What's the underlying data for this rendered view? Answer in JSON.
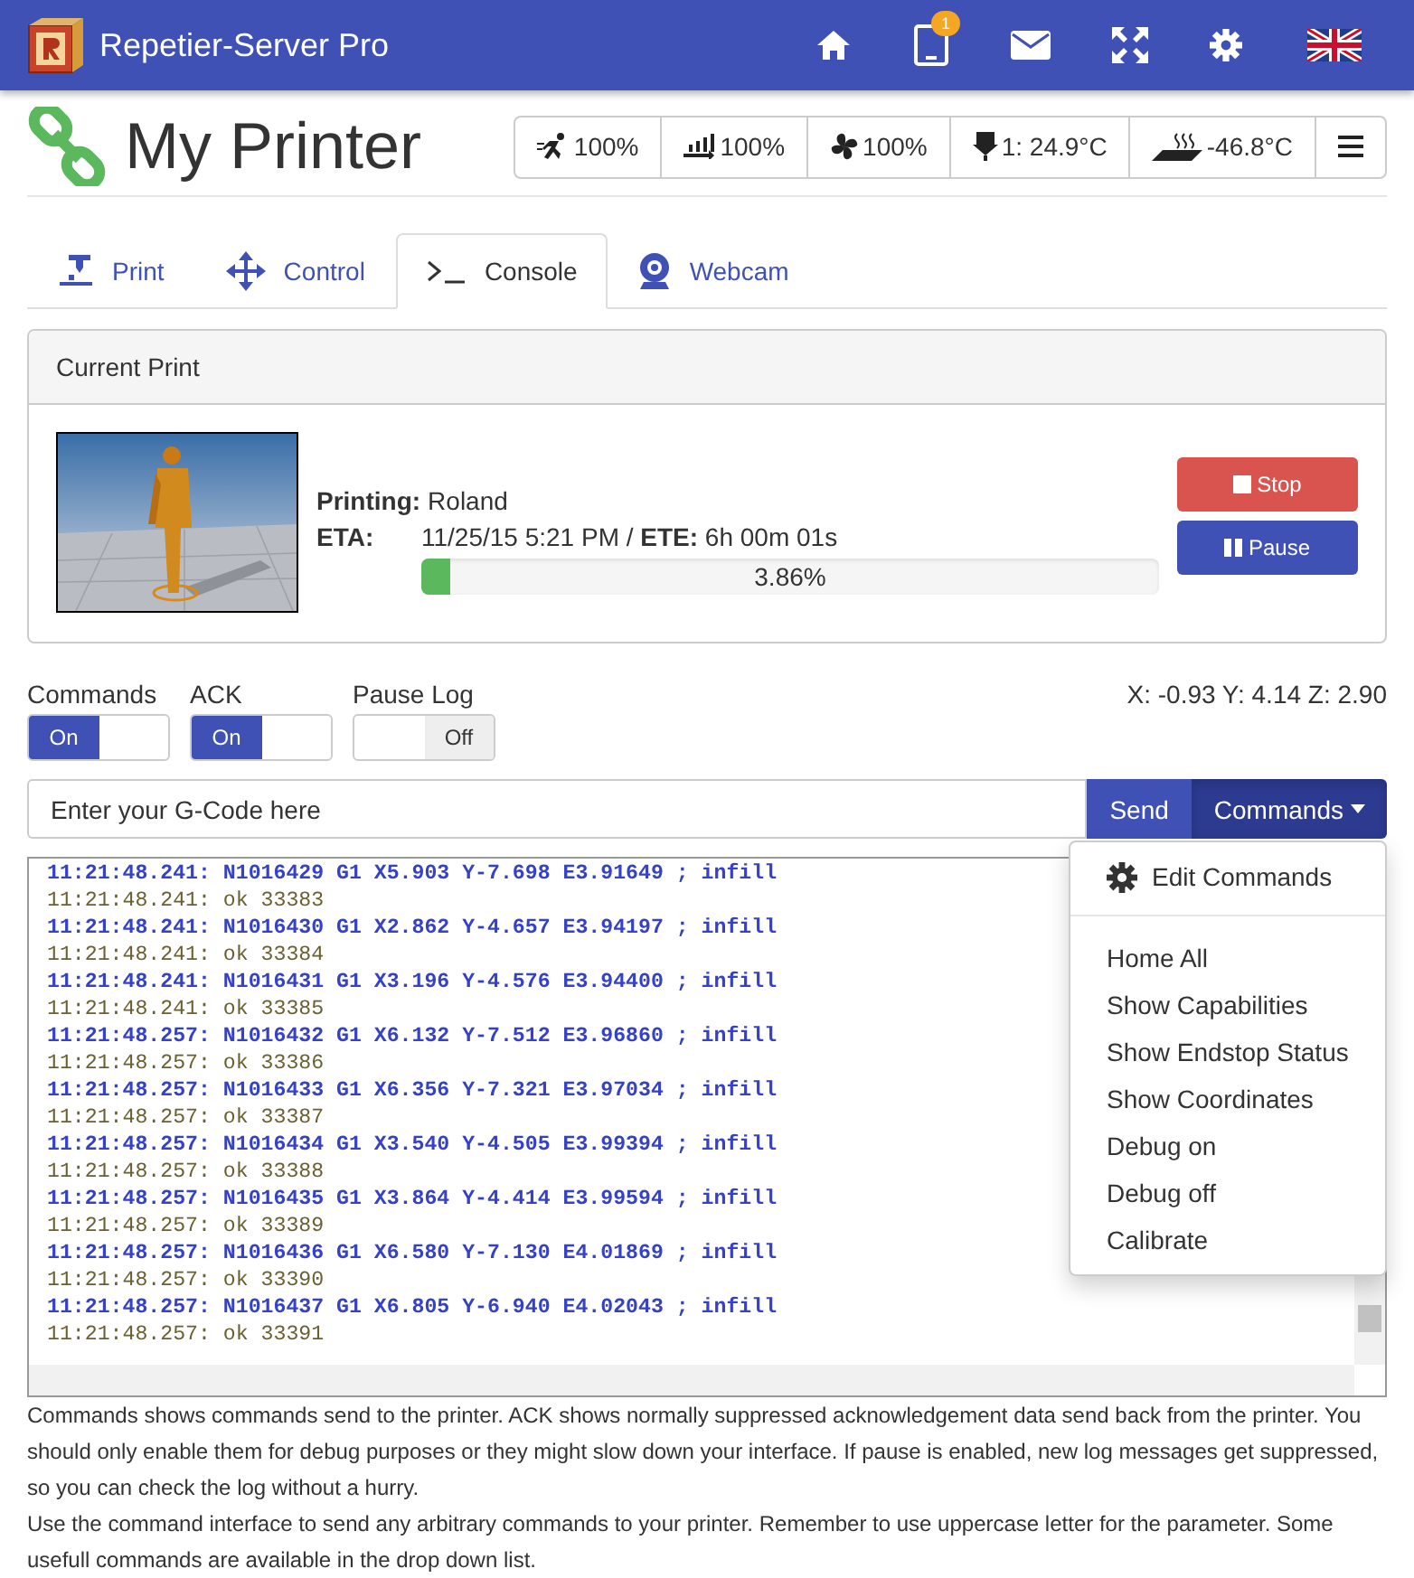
{
  "header": {
    "app_title": "Repetier-Server Pro",
    "notification_count": "1"
  },
  "printer": {
    "name": "My Printer"
  },
  "status": [
    {
      "kind": "speed",
      "text": "100%"
    },
    {
      "kind": "flow",
      "text": "100%"
    },
    {
      "kind": "fan",
      "text": "100%"
    },
    {
      "kind": "extruder",
      "text": "1: 24.9°C"
    },
    {
      "kind": "bed",
      "text": "-46.8°C"
    },
    {
      "kind": "menu"
    }
  ],
  "tabs": [
    {
      "kind": "print",
      "label": "Print",
      "selected": false
    },
    {
      "kind": "control",
      "label": "Control",
      "selected": false
    },
    {
      "kind": "console",
      "label": "Console",
      "selected": true
    },
    {
      "kind": "webcam",
      "label": "Webcam",
      "selected": false
    }
  ],
  "current_print": {
    "title": "Current Print",
    "printing_label": "Printing:",
    "printing": "Roland",
    "eta_label": "ETA:",
    "eta": "11/25/15 5:21 PM / **ETE:** 6h 00m 01s",
    "progress_text": "3.86%",
    "level": 0.0386,
    "stop": "Stop",
    "pause": "Pause"
  },
  "toggles": [
    {
      "label": "Commands",
      "on": true,
      "state_text": "On"
    },
    {
      "label": "ACK",
      "on": true,
      "state_text": "On"
    },
    {
      "label": "Pause Log",
      "on": false,
      "state_text": "Off"
    }
  ],
  "coordinates": "X: -0.93 Y: 4.14 Z: 2.90",
  "gcode": {
    "placeholder": "Enter your G-Code here",
    "send": "Send",
    "commands": "Commands"
  },
  "console": [
    {
      "kind": "command",
      "text": "11:21:48.241: N1016429 G1 X5.903 Y-7.698 E3.91649 ; infill"
    },
    {
      "kind": "response",
      "text": "11:21:48.241: ok 33383"
    },
    {
      "kind": "command",
      "text": "11:21:48.241: N1016430 G1 X2.862 Y-4.657 E3.94197 ; infill"
    },
    {
      "kind": "response",
      "text": "11:21:48.241: ok 33384"
    },
    {
      "kind": "command",
      "text": "11:21:48.241: N1016431 G1 X3.196 Y-4.576 E3.94400 ; infill"
    },
    {
      "kind": "response",
      "text": "11:21:48.241: ok 33385"
    },
    {
      "kind": "command",
      "text": "11:21:48.257: N1016432 G1 X6.132 Y-7.512 E3.96860 ; infill"
    },
    {
      "kind": "response",
      "text": "11:21:48.257: ok 33386"
    },
    {
      "kind": "command",
      "text": "11:21:48.257: N1016433 G1 X6.356 Y-7.321 E3.97034 ; infill"
    },
    {
      "kind": "response",
      "text": "11:21:48.257: ok 33387"
    },
    {
      "kind": "command",
      "text": "11:21:48.257: N1016434 G1 X3.540 Y-4.505 E3.99394 ; infill"
    },
    {
      "kind": "response",
      "text": "11:21:48.257: ok 33388"
    },
    {
      "kind": "command",
      "text": "11:21:48.257: N1016435 G1 X3.864 Y-4.414 E3.99594 ; infill"
    },
    {
      "kind": "response",
      "text": "11:21:48.257: ok 33389"
    },
    {
      "kind": "command",
      "text": "11:21:48.257: N1016436 G1 X6.580 Y-7.130 E4.01869 ; infill"
    },
    {
      "kind": "response",
      "text": "11:21:48.257: ok 33390"
    },
    {
      "kind": "command",
      "text": "11:21:48.257: N1016437 G1 X6.805 Y-6.940 E4.02043 ; infill"
    },
    {
      "kind": "response",
      "text": "11:21:48.257: ok 33391"
    }
  ],
  "commands_menu": {
    "expanded": true,
    "items": [
      {
        "kind": "edit",
        "label": "Edit Commands"
      },
      {
        "kind": "command",
        "label": "Home All"
      },
      {
        "kind": "command",
        "label": "Show Capabilities"
      },
      {
        "kind": "command",
        "label": "Show Endstop Status"
      },
      {
        "kind": "command",
        "label": "Show Coordinates"
      },
      {
        "kind": "command",
        "label": "Debug on"
      },
      {
        "kind": "command",
        "label": "Debug off"
      },
      {
        "kind": "command",
        "label": "Calibrate"
      }
    ]
  },
  "help": [
    "Commands shows commands send to the printer. ACK shows normally suppressed acknowledgement data send back from the printer. You should only enable them for debug purposes or they might slow down your interface. If pause is enabled, new log messages get suppressed, so you can check the log without a hurry.",
    "Use the command interface to send any arbitrary commands to your printer. Remember to use uppercase letter for the parameter. Some usefull commands are available in the drop down list."
  ]
}
